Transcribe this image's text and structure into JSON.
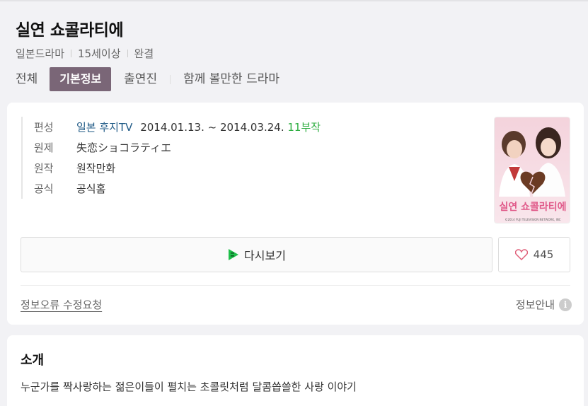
{
  "header": {
    "title": "실연 쇼콜라티에",
    "meta": [
      "일본드라마",
      "15세이상",
      "완결"
    ]
  },
  "tabs": [
    {
      "label": "전체",
      "active": false
    },
    {
      "label": "기본정보",
      "active": true
    },
    {
      "label": "출연진",
      "active": false
    },
    {
      "label": "함께 볼만한 드라마",
      "active": false
    }
  ],
  "info": {
    "broadcast": {
      "key": "편성",
      "channel": "일본 후지TV",
      "period": "2014.01.13. ~ 2014.03.24.",
      "episodes": "11부작"
    },
    "original_title": {
      "key": "원제",
      "value": "失恋ショコラティエ"
    },
    "original_work": {
      "key": "원작",
      "value": "원작만화"
    },
    "official": {
      "key": "공식",
      "value": "공식홈"
    }
  },
  "poster": {
    "title_text": "실연 쇼콜라티에",
    "copyright": "©2014 FUJI TELEVISION NETWORK, INC"
  },
  "actions": {
    "watch_label": "다시보기",
    "like_count": "445"
  },
  "footer_links": {
    "report": "정보오류 수정요청",
    "guide": "정보안내"
  },
  "intro": {
    "heading": "소개",
    "text": "누군가를 짝사랑하는 젊은이들이 펼치는 초콜릿처럼 달콤씁쓸한 사랑 이야기"
  },
  "colors": {
    "active_tab": "#7a6677",
    "link": "#1f5a86",
    "episodes": "#2fae42"
  }
}
